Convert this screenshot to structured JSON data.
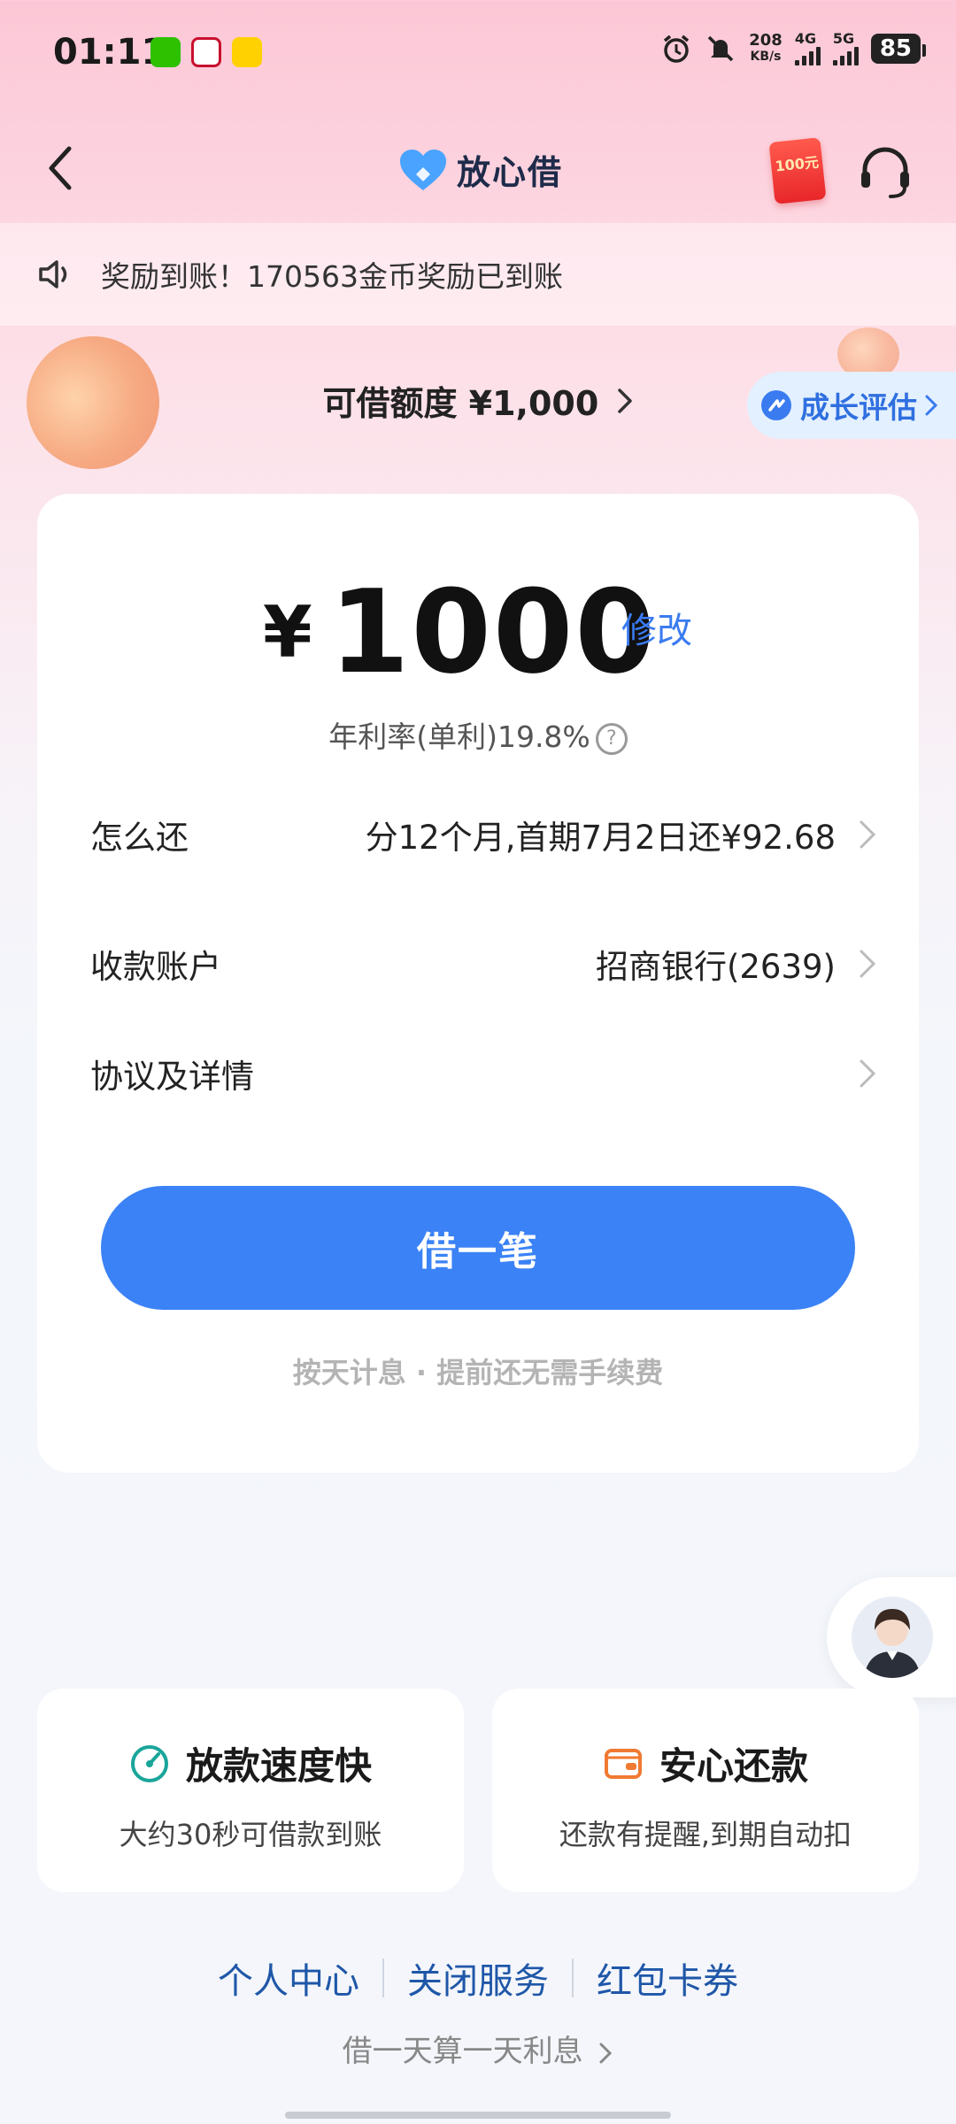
{
  "status_bar": {
    "time": "01:11",
    "net_speed_value": "208",
    "net_speed_unit": "KB/s",
    "signal_1": "4G",
    "signal_2": "5G",
    "battery": "85"
  },
  "header": {
    "brand": "放心借",
    "redpacket_label": "100元"
  },
  "notice": {
    "text": "奖励到账！170563金币奖励已到账"
  },
  "limit": {
    "text": "可借额度 ¥1,000",
    "growth_label": "成长评估"
  },
  "loan": {
    "currency": "¥",
    "amount": "1000",
    "modify_label": "修改",
    "rate_text": "年利率(单利)19.8%",
    "rows": [
      {
        "label": "怎么还",
        "value": "分12个月,首期7月2日还¥92.68"
      },
      {
        "label": "收款账户",
        "value": "招商银行(2639)"
      },
      {
        "label": "协议及详情",
        "value": ""
      }
    ],
    "borrow_label": "借一笔",
    "hint": "按天计息 · 提前还无需手续费"
  },
  "features": [
    {
      "title": "放款速度快",
      "desc": "大约30秒可借款到账",
      "icon": "speed-icon",
      "color": "#1aa59a"
    },
    {
      "title": "安心还款",
      "desc": "还款有提醒,到期自动扣",
      "icon": "wallet-icon",
      "color": "#f07a32"
    }
  ],
  "links": [
    "个人中心",
    "关闭服务",
    "红包卡券"
  ],
  "footer_note": "借一天算一天利息",
  "colors": {
    "primary": "#3b82f6",
    "link": "#1f57a8",
    "accent_text": "#3a7bf0"
  }
}
